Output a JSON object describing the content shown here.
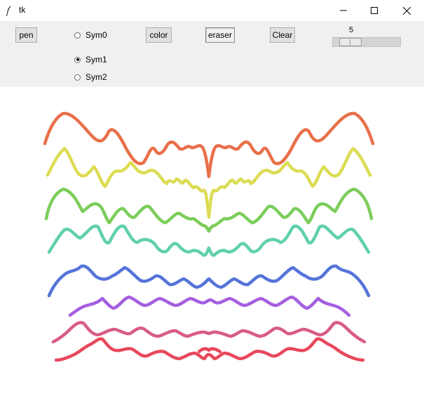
{
  "window": {
    "title": "tk",
    "icons": {
      "app": "feather-icon",
      "minimize": "minimize-icon",
      "maximize": "maximize-icon",
      "close": "close-icon"
    }
  },
  "toolbar": {
    "pen_label": "pen",
    "color_label": "color",
    "eraser_label": "eraser",
    "clear_label": "Clear",
    "symmetry_options": [
      "Sym0",
      "Sym1",
      "Sym2"
    ],
    "symmetry_selected": "Sym1",
    "brush_size": "5"
  },
  "canvas": {
    "description_strokes": [
      {
        "color": "#e8704a"
      },
      {
        "color": "#dcdc55"
      },
      {
        "color": "#7ccd5b"
      },
      {
        "color": "#60d1a7"
      },
      {
        "color": "#5574d9"
      },
      {
        "color": "#a55ee0"
      },
      {
        "color": "#d85c8a"
      },
      {
        "color": "#e8485c"
      }
    ]
  }
}
